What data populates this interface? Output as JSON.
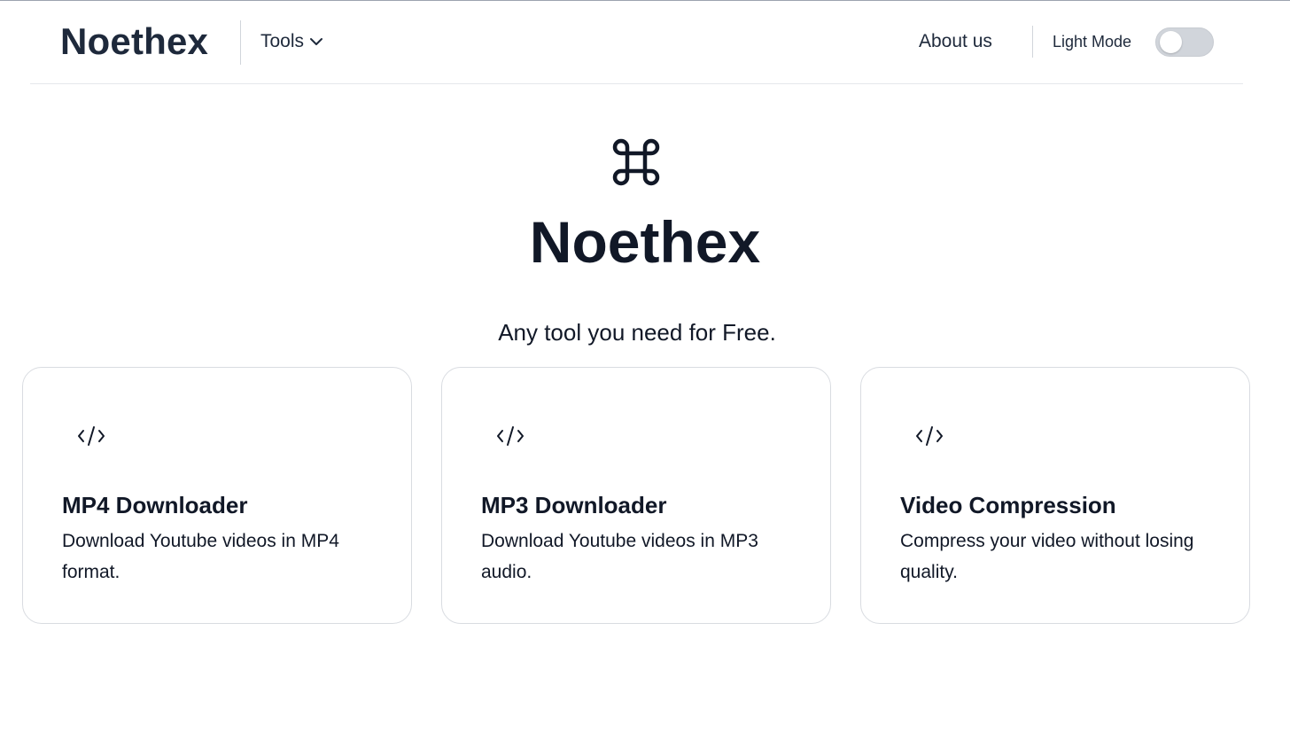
{
  "header": {
    "brand": "Noethex",
    "tools_label": "Tools",
    "about_label": "About us",
    "mode_label": "Light Mode",
    "mode_toggle_on": false
  },
  "hero": {
    "icon": "command-icon",
    "title": "Noethex",
    "subtitle": "Any tool you need for Free."
  },
  "cards": [
    {
      "icon": "code-icon",
      "title": "MP4 Downloader",
      "description": "Download Youtube videos in MP4 format."
    },
    {
      "icon": "code-icon",
      "title": "MP3 Downloader",
      "description": "Download Youtube videos in MP3 audio."
    },
    {
      "icon": "code-icon",
      "title": "Video Compression",
      "description": "Compress your video without losing quality."
    }
  ],
  "colors": {
    "text": "#111827",
    "brand": "#1e293b",
    "border": "#d9dce1",
    "toggle_off": "#d1d5db"
  }
}
